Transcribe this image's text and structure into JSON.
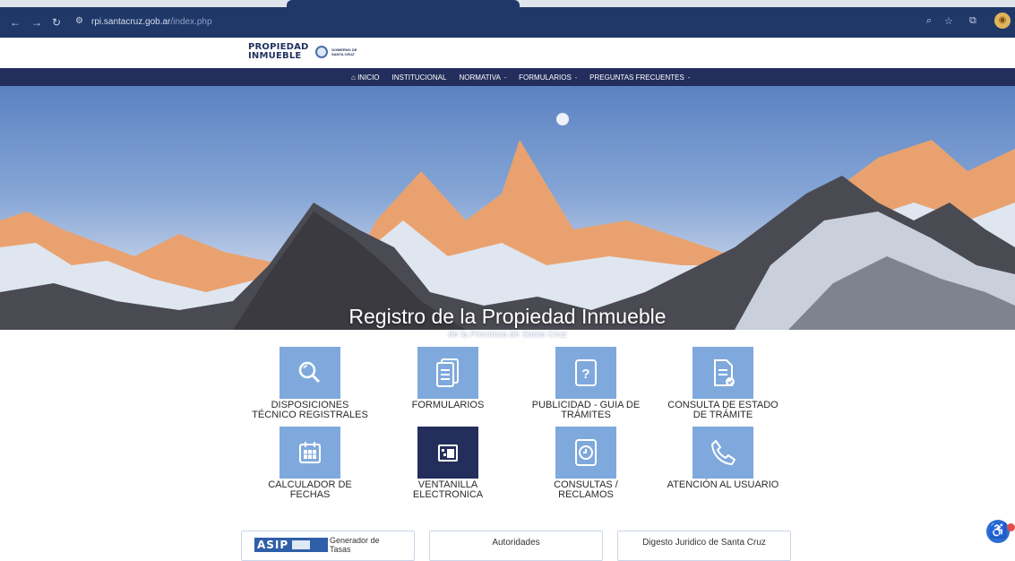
{
  "browser": {
    "url_domain": "rpi.santacruz.gob.ar",
    "url_path": "/index.php",
    "icons": [
      "back-arrow-icon",
      "forward-arrow-icon",
      "reload-icon",
      "site-settings-icon",
      "zoom-icon",
      "bookmark-star-icon",
      "extensions-icon",
      "profile-avatar-icon"
    ]
  },
  "header": {
    "logo_line1": "PROPIEDAD",
    "logo_line2": "INMUEBLE",
    "gov_line1": "GOBIERNO DE",
    "gov_line2": "SANTA CRUZ"
  },
  "nav": {
    "items": [
      {
        "label": "INICIO",
        "icon": "home-icon",
        "dropdown": false
      },
      {
        "label": "INSTITUCIONAL",
        "dropdown": false
      },
      {
        "label": "NORMATIVA",
        "dropdown": true
      },
      {
        "label": "FORMULARIOS",
        "dropdown": true
      },
      {
        "label": "PREGUNTAS FRECUENTES",
        "dropdown": true
      }
    ],
    "caret": "-"
  },
  "hero": {
    "title": "Registro de la Propiedad Inmueble",
    "subtitle": "de la Provincia de Santa Cruz"
  },
  "tiles": [
    {
      "label": "DISPOSICIONES TÉCNICO REGISTRALES",
      "icon": "search-icon"
    },
    {
      "label": "FORMULARIOS",
      "icon": "documents-icon"
    },
    {
      "label": "PUBLICIDAD - GUIA DE TRÁMITES",
      "icon": "help-document-icon"
    },
    {
      "label": "CONSULTA DE ESTADO DE TRÁMITE",
      "icon": "document-check-icon"
    },
    {
      "label": "CALCULADOR DE FECHAS",
      "icon": "calendar-icon"
    },
    {
      "label": "VENTANILLA ELECTRONICA",
      "icon": "electronic-window-icon"
    },
    {
      "label": "CONSULTAS / RECLAMOS",
      "icon": "clock-document-icon"
    },
    {
      "label": "ATENCIÓN AL USUARIO",
      "icon": "phone-icon"
    }
  ],
  "bottom_links": {
    "asip_logo": "ASIP",
    "asip_text": "Generador de Tasas",
    "autoridades": "Autoridades",
    "digesto": "Digesto Juridico de Santa Cruz"
  },
  "colors": {
    "nav_bg": "#232e5c",
    "tile_bg": "#7fa9dc",
    "tile_active_bg": "#232e5c",
    "browser_bg": "#1f3868"
  }
}
